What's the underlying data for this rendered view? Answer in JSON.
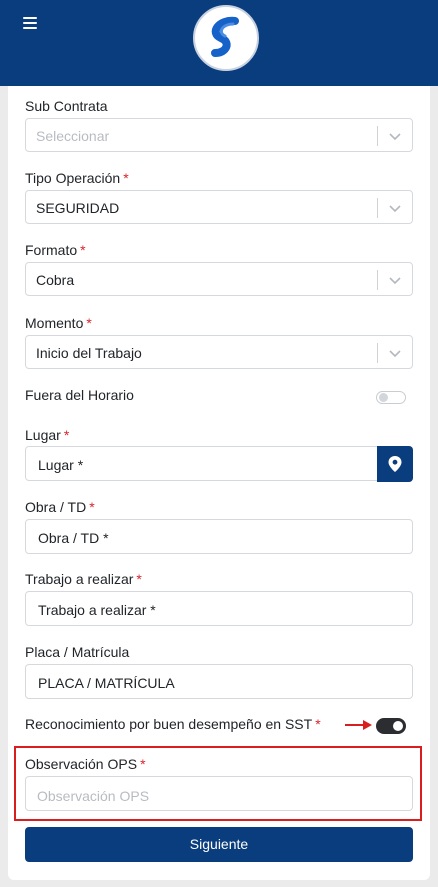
{
  "header": {
    "menu_icon": "hamburger-menu-icon",
    "logo_icon": "swirl-s-logo",
    "brand_color": "#0a3d7e"
  },
  "form": {
    "sub_contrata": {
      "label": "Sub Contrata",
      "placeholder": "Seleccionar"
    },
    "tipo_operacion": {
      "label": "Tipo Operación",
      "required_mark": "*",
      "value": "SEGURIDAD"
    },
    "formato": {
      "label": "Formato",
      "required_mark": "*",
      "value": "Cobra"
    },
    "momento": {
      "label": "Momento",
      "required_mark": "*",
      "value": "Inicio del Trabajo"
    },
    "fuera_horario": {
      "label": "Fuera del Horario",
      "checked": false
    },
    "lugar": {
      "label": "Lugar",
      "required_mark": "*",
      "value": "Lugar *",
      "button_icon": "map-marker-icon"
    },
    "obra_td": {
      "label": "Obra / TD",
      "required_mark": "*",
      "value": "Obra / TD *"
    },
    "trabajo": {
      "label": "Trabajo a realizar",
      "required_mark": "*",
      "value": "Trabajo a realizar *"
    },
    "placa": {
      "label": "Placa / Matrícula",
      "value": "PLACA / MATRÍCULA"
    },
    "reconocimiento": {
      "label": "Reconocimiento por buen desempeño en SST",
      "required_mark": "*",
      "checked": true
    },
    "observacion": {
      "label": "Observación OPS",
      "required_mark": "*",
      "placeholder": "Observación OPS"
    },
    "submit_label": "Siguiente"
  },
  "annotations": {
    "highlight_color": "#d81e1e"
  }
}
